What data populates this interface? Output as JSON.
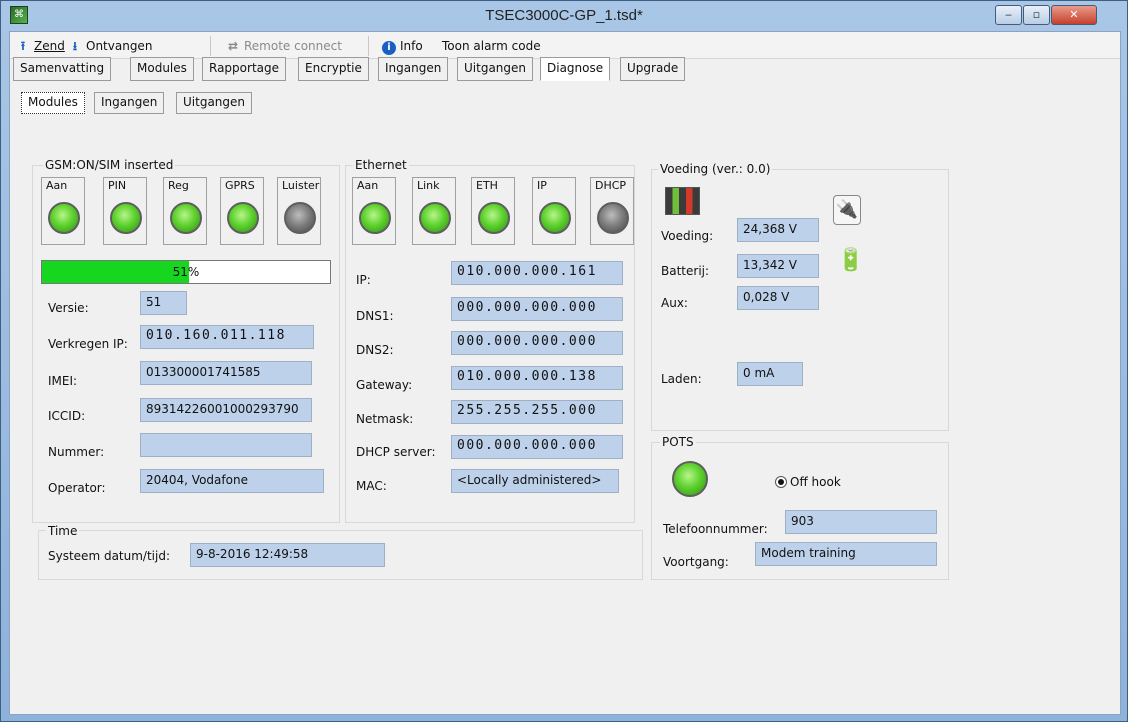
{
  "window": {
    "title": "TSEC3000C-GP_1.tsd*"
  },
  "toolbar": {
    "zend": "Zend",
    "ontvangen": "Ontvangen",
    "remote_connect": "Remote connect",
    "info": "Info",
    "toon_alarm_code": "Toon alarm code"
  },
  "tabs": [
    "Samenvatting",
    "Modules",
    "Rapportage",
    "Encryptie",
    "Ingangen",
    "Uitgangen",
    "Diagnose",
    "Upgrade"
  ],
  "active_tab": "Diagnose",
  "subtabs": [
    "Modules",
    "Ingangen",
    "Uitgangen"
  ],
  "gsm": {
    "title": "GSM:ON/SIM inserted",
    "leds": [
      {
        "label": "Aan",
        "state": "on"
      },
      {
        "label": "PIN",
        "state": "on"
      },
      {
        "label": "Reg",
        "state": "on"
      },
      {
        "label": "GPRS",
        "state": "on"
      },
      {
        "label": "Luister",
        "state": "off"
      }
    ],
    "progress_percent": 51,
    "progress_text": "51%",
    "labels": {
      "versie": "Versie:",
      "verkregen_ip": "Verkregen IP:",
      "imei": "IMEI:",
      "iccid": "ICCID:",
      "nummer": "Nummer:",
      "operator": "Operator:"
    },
    "values": {
      "versie": "51",
      "verkregen_ip": "010.160.011.118",
      "imei": "013300001741585",
      "iccid": "89314226001000293790",
      "nummer": "",
      "operator": "20404, Vodafone"
    }
  },
  "ethernet": {
    "title": "Ethernet",
    "leds": [
      {
        "label": "Aan",
        "state": "on"
      },
      {
        "label": "Link",
        "state": "on"
      },
      {
        "label": "ETH",
        "state": "on"
      },
      {
        "label": "IP",
        "state": "on"
      },
      {
        "label": "DHCP",
        "state": "off"
      }
    ],
    "labels": {
      "ip": "IP:",
      "dns1": "DNS1:",
      "dns2": "DNS2:",
      "gateway": "Gateway:",
      "netmask": "Netmask:",
      "dhcp_server": "DHCP server:",
      "mac": "MAC:"
    },
    "values": {
      "ip": "010.000.000.161",
      "dns1": "000.000.000.000",
      "dns2": "000.000.000.000",
      "gateway": "010.000.000.138",
      "netmask": "255.255.255.000",
      "dhcp_server": "000.000.000.000",
      "mac": "<Locally administered>"
    }
  },
  "voeding": {
    "title": "Voeding (ver.: 0.0)",
    "labels": {
      "voeding": "Voeding:",
      "batterij": "Batterij:",
      "aux": "Aux:",
      "laden": "Laden:"
    },
    "values": {
      "voeding": "24,368 V",
      "batterij": "13,342 V",
      "aux": "0,028 V",
      "laden": "0 mA"
    }
  },
  "pots": {
    "title": "POTS",
    "led_state": "on",
    "radio_label": "Off hook",
    "labels": {
      "telefoonnummer": "Telefoonnummer:",
      "voortgang": "Voortgang:"
    },
    "values": {
      "telefoonnummer": "903",
      "voortgang": "Modem training"
    }
  },
  "time": {
    "title": "Time",
    "label": "Systeem datum/tijd:",
    "value": "9-8-2016 12:49:58"
  },
  "colors": {
    "led_on": "#5fd22f",
    "led_off": "#7a7a7a",
    "field_bg": "#bdd1ea",
    "progress": "#17d61f"
  }
}
